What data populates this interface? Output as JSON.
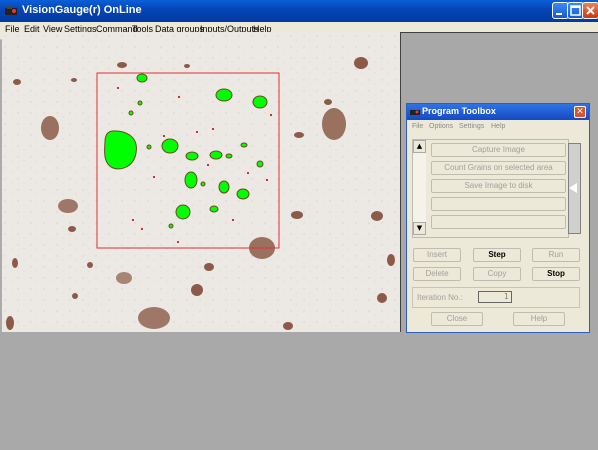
{
  "window": {
    "title": "VisionGauge(r) OnLine",
    "controls": {
      "minimize": "_",
      "maximize": "□",
      "close": "✕"
    }
  },
  "menu": [
    "File",
    "Edit",
    "View",
    "Settings",
    "Command",
    "Tools",
    "Data groups",
    "Inputs/Outputs",
    "Help"
  ],
  "toolbox": {
    "title": "Program Toolbox",
    "close": "✕",
    "menu": [
      "File",
      "Options",
      "Settings",
      "Help"
    ],
    "scroll_up": "▲",
    "scroll_down": "▼",
    "program_items": [
      "Capture Image",
      "Count Grains on selected area",
      "Save Image to disk",
      "",
      ""
    ],
    "buttons": {
      "insert": "Insert",
      "step": "Step",
      "run": "Run",
      "delete": "Delete",
      "copy": "Copy",
      "stop": "Stop",
      "close": "Close",
      "help": "Help"
    },
    "iteration_label": "Iteration No.:",
    "iteration_value": "1"
  },
  "colors": {
    "title_bar": "#0a5fd8",
    "grain_fill": "#00ff00",
    "selection_rect": "#e03030",
    "background_gray": "#ababab"
  }
}
